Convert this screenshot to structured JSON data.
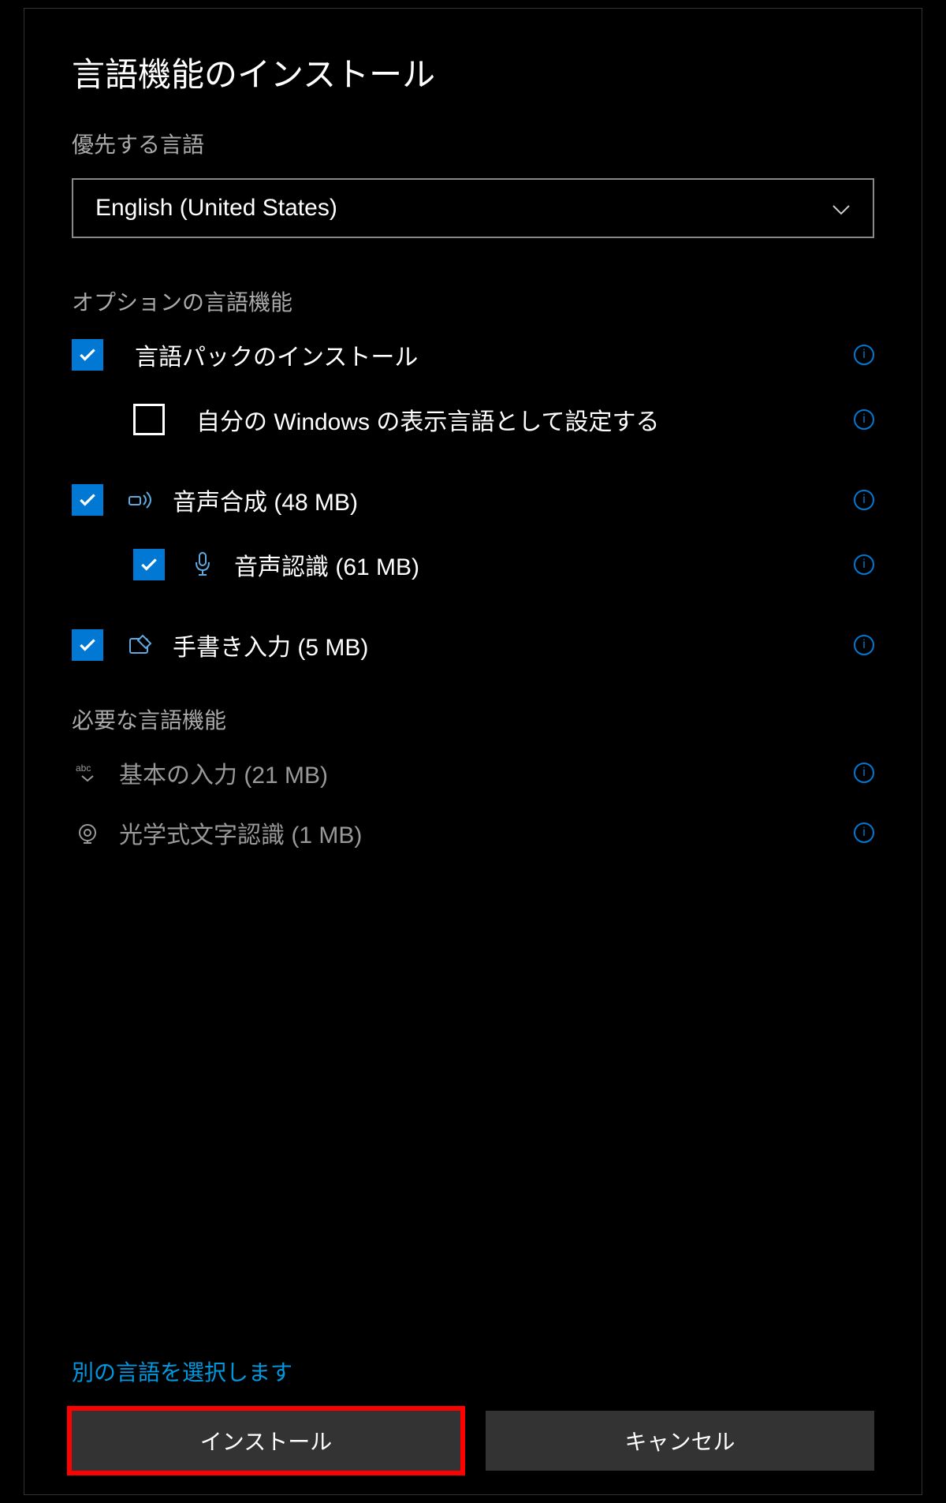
{
  "dialog": {
    "title": "言語機能のインストール",
    "preferred_language_label": "優先する言語",
    "preferred_language_value": "English (United States)",
    "optional_features_label": "オプションの言語機能",
    "required_features_label": "必要な言語機能",
    "select_other_language_link": "別の言語を選択します",
    "install_button": "インストール",
    "cancel_button": "キャンセル"
  },
  "optional_features": [
    {
      "label": "言語パックのインストール",
      "checked": true,
      "has_icon": false,
      "indented": false
    },
    {
      "label": "自分の Windows の表示言語として設定する",
      "checked": false,
      "has_icon": false,
      "indented": true
    },
    {
      "label": "音声合成 (48 MB)",
      "checked": true,
      "has_icon": true,
      "icon": "speaker",
      "indented": false
    },
    {
      "label": "音声認識 (61 MB)",
      "checked": true,
      "has_icon": true,
      "icon": "mic",
      "indented": true
    },
    {
      "label": "手書き入力 (5 MB)",
      "checked": true,
      "has_icon": true,
      "icon": "pen",
      "indented": false
    }
  ],
  "required_features": [
    {
      "label": "基本の入力 (21 MB)",
      "icon": "abc"
    },
    {
      "label": "光学式文字認識 (1 MB)",
      "icon": "ocr"
    }
  ]
}
